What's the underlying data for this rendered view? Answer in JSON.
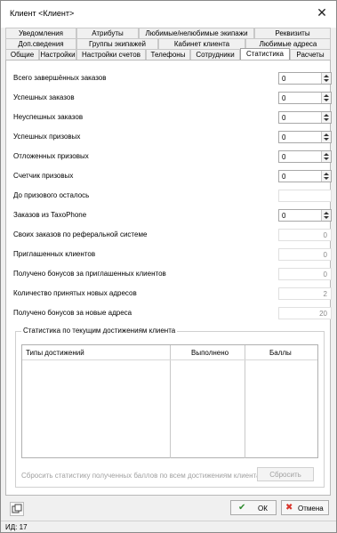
{
  "window": {
    "title": "Клиент <Клиент>"
  },
  "tabs": {
    "row1": [
      "Уведомления",
      "Атрибуты",
      "Любимые/нелюбимые экипажи",
      "Реквизиты"
    ],
    "row2": [
      "Доп.сведения",
      "Группы экипажей",
      "Кабинет клиента",
      "Любимые адреса"
    ],
    "row3": [
      "Общие",
      "Настройки",
      "Настройки счетов",
      "Телефоны",
      "Сотрудники",
      "Статистика",
      "Расчеты"
    ],
    "active": "Статистика"
  },
  "stats": [
    {
      "label": "Всего завершённых заказов",
      "value": "0",
      "kind": "spin"
    },
    {
      "label": "Успешных заказов",
      "value": "0",
      "kind": "spin"
    },
    {
      "label": "Неуспешных заказов",
      "value": "0",
      "kind": "spin"
    },
    {
      "label": "Успешных призовых",
      "value": "0",
      "kind": "spin"
    },
    {
      "label": "Отложенных призовых",
      "value": "0",
      "kind": "spin"
    },
    {
      "label": "Счетчик призовых",
      "value": "0",
      "kind": "spin"
    },
    {
      "label": "До призового осталось",
      "value": "",
      "kind": "empty"
    },
    {
      "label": "Заказов из TaxoPhone",
      "value": "0",
      "kind": "spin"
    },
    {
      "label": "Своих заказов по реферальной системе",
      "value": "0",
      "kind": "ro"
    },
    {
      "label": "Приглашенных клиентов",
      "value": "0",
      "kind": "ro"
    },
    {
      "label": "Получено бонусов за приглашенных клиентов",
      "value": "0",
      "kind": "ro"
    },
    {
      "label": "Количество принятых новых адресов",
      "value": "2",
      "kind": "ro"
    },
    {
      "label": "Получено бонусов за новые адреса",
      "value": "20",
      "kind": "ro"
    }
  ],
  "achievements": {
    "legend": "Статистика по текущим достижениям клиента",
    "columns": [
      "Типы достижений",
      "Выполнено",
      "Баллы"
    ],
    "reset_label": "Сбросить статистику полученных баллов по всем достижениям клиента",
    "reset_button": "Сбросить"
  },
  "footer": {
    "ok": "ОК",
    "cancel": "Отмена",
    "status": "ИД: 17"
  }
}
